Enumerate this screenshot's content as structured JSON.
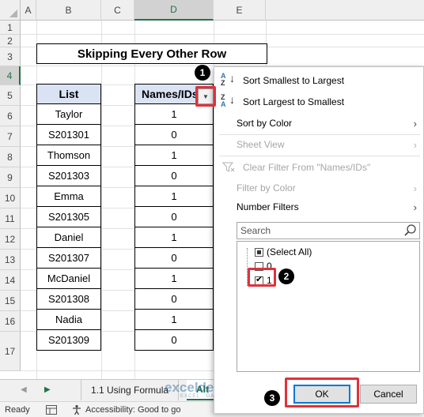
{
  "columns": [
    "A",
    "B",
    "C",
    "D",
    "E"
  ],
  "rows": [
    "1",
    "2",
    "3",
    "4",
    "5",
    "6",
    "7",
    "8",
    "9",
    "10",
    "11",
    "12",
    "13",
    "14",
    "15",
    "16",
    "17"
  ],
  "title": "Skipping Every Other Row",
  "table": {
    "list_header": "List",
    "names_header": "Names/IDs",
    "list": [
      "Taylor",
      "S201301",
      "Thomson",
      "S201303",
      "Emma",
      "S201305",
      "Daniel",
      "S201307",
      "McDaniel",
      "S201308",
      "Nadia",
      "S201309"
    ],
    "values": [
      "1",
      "0",
      "1",
      "0",
      "1",
      "0",
      "1",
      "0",
      "1",
      "0",
      "1",
      "0"
    ]
  },
  "filter_menu": {
    "sort_asc": "Sort Smallest to Largest",
    "sort_desc": "Sort Largest to Smallest",
    "sort_by_color": "Sort by Color",
    "sheet_view": "Sheet View",
    "clear_filter": "Clear Filter From \"Names/IDs\"",
    "filter_by_color": "Filter by Color",
    "number_filters": "Number Filters",
    "search_placeholder": "Search",
    "options": [
      {
        "label": "(Select All)",
        "state": "partial"
      },
      {
        "label": "0",
        "state": "unchecked"
      },
      {
        "label": "1",
        "state": "checked"
      }
    ],
    "ok": "OK",
    "cancel": "Cancel"
  },
  "badges": [
    "1",
    "2",
    "3"
  ],
  "sheet_tabs": [
    "1.1 Using Formula",
    "Alt"
  ],
  "watermark": {
    "name": "exceldemy",
    "tagline": "EXCEL · DATA · BI"
  },
  "status": {
    "ready": "Ready",
    "accessibility": "Accessibility: Good to go"
  },
  "colors": {
    "accent": "#217346",
    "header_fill": "#dae3f3",
    "highlight": "#e0313b"
  }
}
